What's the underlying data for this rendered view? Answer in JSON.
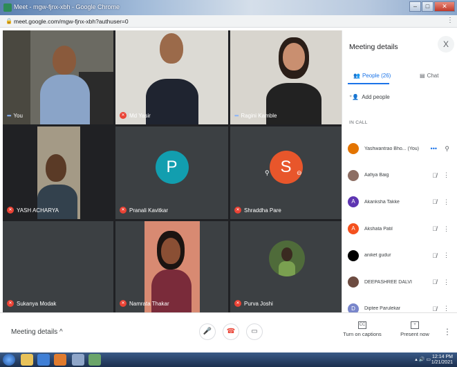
{
  "window": {
    "title": "Meet - mgw-fjnx-xbh - Google Chrome",
    "url": "meet.google.com/mgw-fjnx-xbh?authuser=0"
  },
  "tiles": [
    {
      "name": "You",
      "type": "video",
      "muted": false
    },
    {
      "name": "Md Yasir",
      "type": "video",
      "muted": true
    },
    {
      "name": "Ragini Kamble",
      "type": "video",
      "muted": false
    },
    {
      "name": "YASH ACHARYA",
      "type": "video",
      "muted": true
    },
    {
      "name": "Pranali Kavitkar",
      "type": "avatar",
      "initial": "P",
      "color": "#129eaf",
      "muted": true
    },
    {
      "name": "Shraddha Pare",
      "type": "avatar",
      "initial": "S",
      "color": "#e8562b",
      "muted": true
    },
    {
      "name": "Sukanya Modak",
      "type": "blank",
      "muted": true
    },
    {
      "name": "Namrata Thakar",
      "type": "video",
      "muted": true
    },
    {
      "name": "Purva Joshi",
      "type": "photo",
      "muted": true
    }
  ],
  "sidebar": {
    "title": "Meeting details",
    "close": "X",
    "tabs": {
      "people": "People (26)",
      "chat": "Chat"
    },
    "add_people": "Add people",
    "in_call": "IN CALL",
    "people": [
      {
        "name": "Yashwantrao Bho...",
        "suffix": "(You)",
        "color": "#e37400",
        "initial": ""
      },
      {
        "name": "Aafiya Baig",
        "color": "#8d6e63",
        "initial": ""
      },
      {
        "name": "Akanksha Takke",
        "color": "#5e35b1",
        "initial": "A"
      },
      {
        "name": "Akshata Patil",
        "color": "#f4511e",
        "initial": "A"
      },
      {
        "name": "aniket gudur",
        "color": "#000000",
        "initial": ""
      },
      {
        "name": "DEEPASHREE DALVI",
        "color": "#6d4c41",
        "initial": ""
      },
      {
        "name": "Diptee Parulekar",
        "color": "#7986cb",
        "initial": "D"
      }
    ]
  },
  "bottom": {
    "meeting_details": "Meeting details ^",
    "captions": "Turn on captions",
    "present": "Present now"
  },
  "clock": {
    "time": "12:14 PM",
    "date": "1/21/2021"
  },
  "colors": {
    "accent": "#1a73e8",
    "danger": "#ea4335",
    "tile_bg": "#3c4043"
  }
}
